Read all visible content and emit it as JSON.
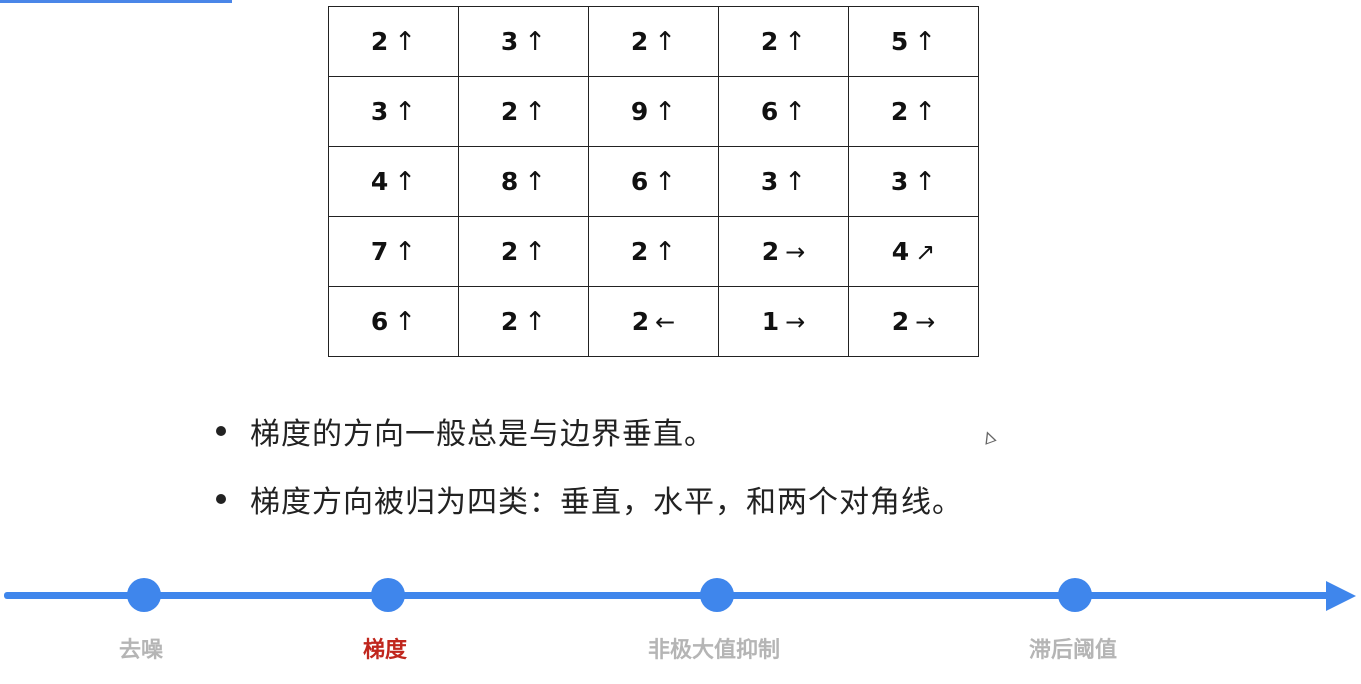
{
  "slide": {
    "grid": [
      [
        {
          "v": "2",
          "a": "↑"
        },
        {
          "v": "3",
          "a": "↑"
        },
        {
          "v": "2",
          "a": "↑"
        },
        {
          "v": "2",
          "a": "↑"
        },
        {
          "v": "5",
          "a": "↑"
        }
      ],
      [
        {
          "v": "3",
          "a": "↑"
        },
        {
          "v": "2",
          "a": "↑"
        },
        {
          "v": "9",
          "a": "↑"
        },
        {
          "v": "6",
          "a": "↑"
        },
        {
          "v": "2",
          "a": "↑"
        }
      ],
      [
        {
          "v": "4",
          "a": "↑"
        },
        {
          "v": "8",
          "a": "↑"
        },
        {
          "v": "6",
          "a": "↑"
        },
        {
          "v": "3",
          "a": "↑"
        },
        {
          "v": "3",
          "a": "↑"
        }
      ],
      [
        {
          "v": "7",
          "a": "↑"
        },
        {
          "v": "2",
          "a": "↑"
        },
        {
          "v": "2",
          "a": "↑"
        },
        {
          "v": "2",
          "a": "→"
        },
        {
          "v": "4",
          "a": "↗"
        }
      ],
      [
        {
          "v": "6",
          "a": "↑"
        },
        {
          "v": "2",
          "a": "↑"
        },
        {
          "v": "2",
          "a": "←"
        },
        {
          "v": "1",
          "a": "→"
        },
        {
          "v": "2",
          "a": "→"
        }
      ]
    ],
    "bullets": [
      "梯度的方向一般总是与边界垂直。",
      "梯度方向被归为四类：垂直，水平，和两个对角线。"
    ]
  },
  "timeline": {
    "color": "#3f86ec",
    "active_color": "#c0261d",
    "inactive_color": "#b5b5b5",
    "stages": [
      {
        "label": "去噪",
        "active": false
      },
      {
        "label": "梯度",
        "active": true
      },
      {
        "label": "非极大值抑制",
        "active": false
      },
      {
        "label": "滞后阈值",
        "active": false
      }
    ]
  }
}
